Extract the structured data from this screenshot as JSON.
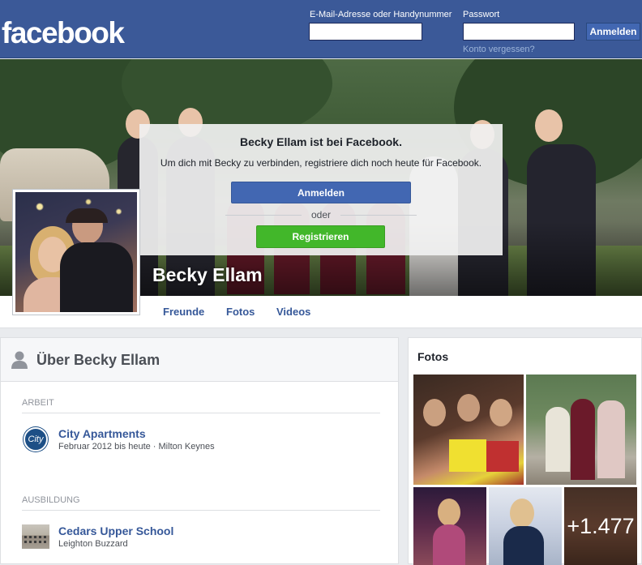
{
  "header": {
    "logo": "facebook",
    "email_label": "E-Mail-Adresse oder Handynummer",
    "password_label": "Passwort",
    "login_button": "Anmelden",
    "forgot_link": "Konto vergessen?",
    "brand_color": "#3b5998"
  },
  "cover": {
    "join_title": "Becky Ellam ist bei Facebook.",
    "join_subtitle": "Um dich mit Becky zu verbinden, registriere dich noch heute für Facebook.",
    "join_login": "Anmelden",
    "or_text": "oder",
    "register": "Registrieren",
    "register_color": "#42b72a"
  },
  "profile": {
    "name": "Becky Ellam"
  },
  "nav": {
    "items": [
      "Freunde",
      "Fotos",
      "Videos"
    ]
  },
  "about": {
    "title": "Über Becky Ellam",
    "work_label": "ARBEIT",
    "work": {
      "title": "City Apartments",
      "sub": "Februar 2012 bis heute · Milton Keynes",
      "logo_text": "City"
    },
    "education_label": "AUSBILDUNG",
    "education": {
      "title": "Cedars Upper School",
      "sub": "Leighton Buzzard"
    }
  },
  "photos": {
    "title": "Fotos",
    "more_count": "+1.477"
  }
}
